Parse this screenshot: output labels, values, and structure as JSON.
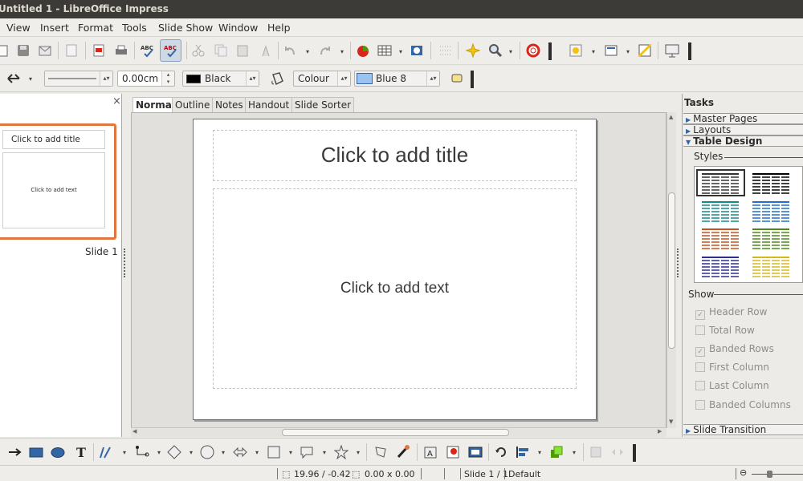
{
  "window": {
    "title": "Untitled 1 - LibreOffice Impress"
  },
  "menu": [
    {
      "label": "View",
      "name": "menu-view"
    },
    {
      "label": "Insert",
      "name": "menu-insert"
    },
    {
      "label": "Format",
      "name": "menu-format"
    },
    {
      "label": "Tools",
      "name": "menu-tools"
    },
    {
      "label": "Slide Show",
      "name": "menu-slide-show"
    },
    {
      "label": "Window",
      "name": "menu-window"
    },
    {
      "label": "Help",
      "name": "menu-help"
    }
  ],
  "line_toolbar": {
    "line_width": "0.00cm",
    "line_color": "Black",
    "area_style": "Colour",
    "area_color": "Blue 8",
    "colors": {
      "line_swatch": "#000000",
      "area_swatch": "#9cc3f0"
    }
  },
  "slide_pane": {
    "close_glyph": "×",
    "thumb_title": "Click to add title",
    "thumb_body": "Click to add text",
    "slide_label": "Slide 1"
  },
  "view_tabs": [
    "Normal",
    "Outline",
    "Notes",
    "Handout",
    "Slide Sorter"
  ],
  "slide": {
    "title_placeholder": "Click to add title",
    "body_placeholder": "Click to add text"
  },
  "tasks": {
    "title": "Tasks",
    "sections": [
      "Master Pages",
      "Layouts",
      "Table Design",
      "Slide Transition"
    ],
    "styles_label": "Styles",
    "show_label": "Show",
    "show_options": [
      {
        "label": "Header Row",
        "checked": true
      },
      {
        "label": "Total Row",
        "checked": false
      },
      {
        "label": "Banded Rows",
        "checked": true
      },
      {
        "label": "First Column",
        "checked": false
      },
      {
        "label": "Last Column",
        "checked": false
      },
      {
        "label": "Banded Columns",
        "checked": false
      }
    ],
    "style_colors": [
      "#333333",
      "#000000",
      "#138a8a",
      "#1e6fd0",
      "#c7501c",
      "#4c8b1a",
      "#2e2e8f",
      "#d6b81a"
    ]
  },
  "status": {
    "position": "19.96 / -0.42",
    "size": "0.00 x 0.00",
    "slide": "Slide 1 / 1",
    "master": "Default"
  }
}
